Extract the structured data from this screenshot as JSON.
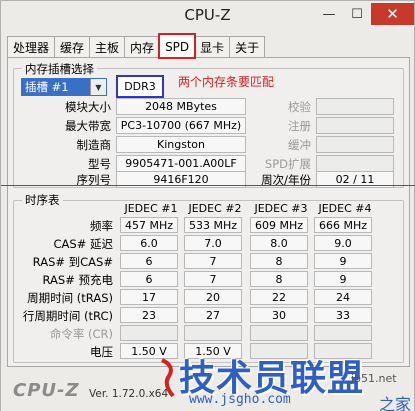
{
  "window": {
    "title": "CPU-Z",
    "min_glyph": "—",
    "max_glyph": "☐",
    "close_glyph": "✕"
  },
  "tabs": [
    {
      "label": "处理器"
    },
    {
      "label": "缓存"
    },
    {
      "label": "主板"
    },
    {
      "label": "内存"
    },
    {
      "label": "SPD",
      "active": true
    },
    {
      "label": "显卡"
    },
    {
      "label": "关于"
    }
  ],
  "slot_group": {
    "legend": "内存插槽选择",
    "slot_selected": "插槽 #1",
    "type": "DDR3",
    "annotation": "两个内存条要匹配",
    "rows": [
      {
        "label": "模块大小",
        "value": "2048 MBytes",
        "rlabel": "校验",
        "rvalue": ""
      },
      {
        "label": "最大带宽",
        "value": "PC3-10700 (667 MHz)",
        "rlabel": "注册",
        "rvalue": ""
      },
      {
        "label": "制造商",
        "value": "Kingston",
        "rlabel": "缓冲",
        "rvalue": ""
      },
      {
        "label": "型号",
        "value": "9905471-001.A00LF",
        "rlabel": "SPD扩展",
        "rvalue": ""
      },
      {
        "label": "序列号",
        "value": "9416F120",
        "rlabel": "周次/年份",
        "rvalue": "02 / 11"
      }
    ]
  },
  "timing_group": {
    "legend": "时序表",
    "columns": [
      "JEDEC #1",
      "JEDEC #2",
      "JEDEC #3",
      "JEDEC #4"
    ],
    "rows": [
      {
        "label": "频率",
        "values": [
          "457 MHz",
          "533 MHz",
          "609 MHz",
          "666 MHz"
        ]
      },
      {
        "label": "CAS# 延迟",
        "values": [
          "6.0",
          "7.0",
          "8.0",
          "9.0"
        ]
      },
      {
        "label": "RAS# 到CAS#",
        "values": [
          "6",
          "7",
          "8",
          "9"
        ]
      },
      {
        "label": "RAS# 预充电",
        "values": [
          "6",
          "7",
          "8",
          "9"
        ]
      },
      {
        "label": "周期时间 (tRAS)",
        "values": [
          "17",
          "20",
          "22",
          "24"
        ]
      },
      {
        "label": "行周期时间 (tRC)",
        "values": [
          "23",
          "27",
          "30",
          "33"
        ]
      },
      {
        "label": "命令率 (CR)",
        "values": [
          "",
          "",
          "",
          ""
        ]
      },
      {
        "label": "电压",
        "values": [
          "1.50 V",
          "1.50 V",
          "",
          ""
        ]
      }
    ]
  },
  "footer": {
    "brand": "CPU-Z",
    "version": "Ver. 1.72.0.x64"
  },
  "watermark": {
    "text": "技术员联盟",
    "url": "www.jsgho.com",
    "small": "jb51.net",
    "home": "之家"
  }
}
